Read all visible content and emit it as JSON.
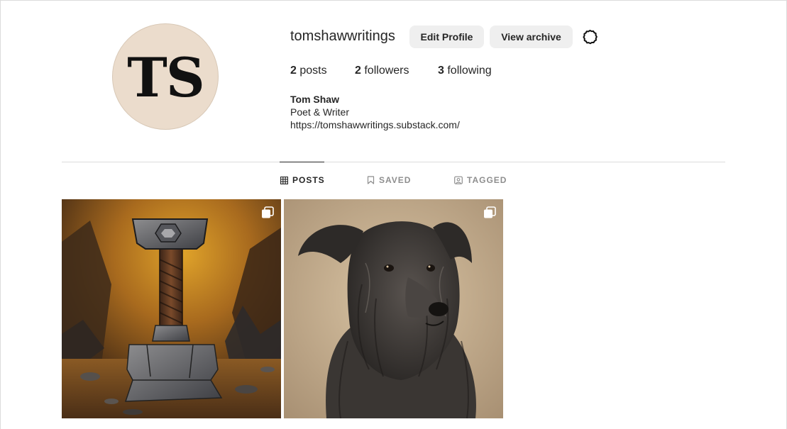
{
  "profile": {
    "avatar_initials": "TS",
    "username": "tomshawwritings",
    "edit_label": "Edit Profile",
    "archive_label": "View archive",
    "settings_icon": "gear-icon"
  },
  "stats": {
    "posts_count": "2",
    "posts_label": "posts",
    "followers_count": "2",
    "followers_label": "followers",
    "following_count": "3",
    "following_label": "following"
  },
  "bio": {
    "name": "Tom Shaw",
    "tagline": "Poet & Writer",
    "link": "https://tomshawwritings.substack.com/"
  },
  "tabs": [
    {
      "label": "POSTS",
      "icon": "grid-icon",
      "active": true
    },
    {
      "label": "SAVED",
      "icon": "bookmark-icon",
      "active": false
    },
    {
      "label": "TAGGED",
      "icon": "tag-user-icon",
      "active": false
    }
  ],
  "posts": [
    {
      "subject": "hammer painting",
      "icon": "multiple-images-icon"
    },
    {
      "subject": "dog portrait",
      "icon": "multiple-images-icon"
    }
  ],
  "colors": {
    "avatar_bg": "#ebdccc",
    "button_bg": "#efefef",
    "text": "#262626",
    "muted": "#8e8e8e",
    "divider": "#dbdbdb"
  }
}
